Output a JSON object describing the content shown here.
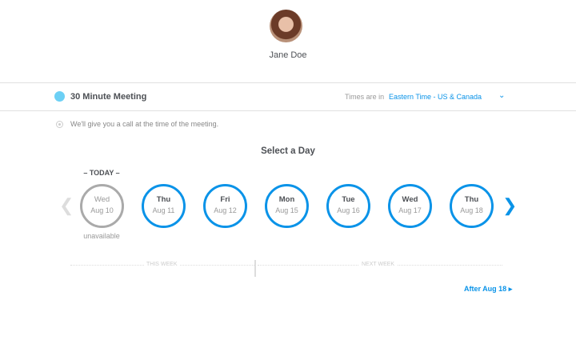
{
  "host": {
    "name": "Jane Doe"
  },
  "event": {
    "title": "30 Minute Meeting",
    "color": "#6cd0f5"
  },
  "timezone": {
    "label": "Times are in",
    "value": "Eastern Time - US & Canada"
  },
  "location_note": "We'll give you a call at the time of the meeting.",
  "select_heading": "Select a Day",
  "today_label": "– TODAY –",
  "days": [
    {
      "dow": "Wed",
      "date": "Aug 10",
      "status": "unavailable"
    },
    {
      "dow": "Thu",
      "date": "Aug 11"
    },
    {
      "dow": "Fri",
      "date": "Aug 12"
    },
    {
      "dow": "Mon",
      "date": "Aug 15"
    },
    {
      "dow": "Tue",
      "date": "Aug 16"
    },
    {
      "dow": "Wed",
      "date": "Aug 17"
    },
    {
      "dow": "Thu",
      "date": "Aug 18"
    }
  ],
  "weeks": {
    "this": "THIS WEEK",
    "next": "NEXT WEEK"
  },
  "after_link": "After Aug 18"
}
